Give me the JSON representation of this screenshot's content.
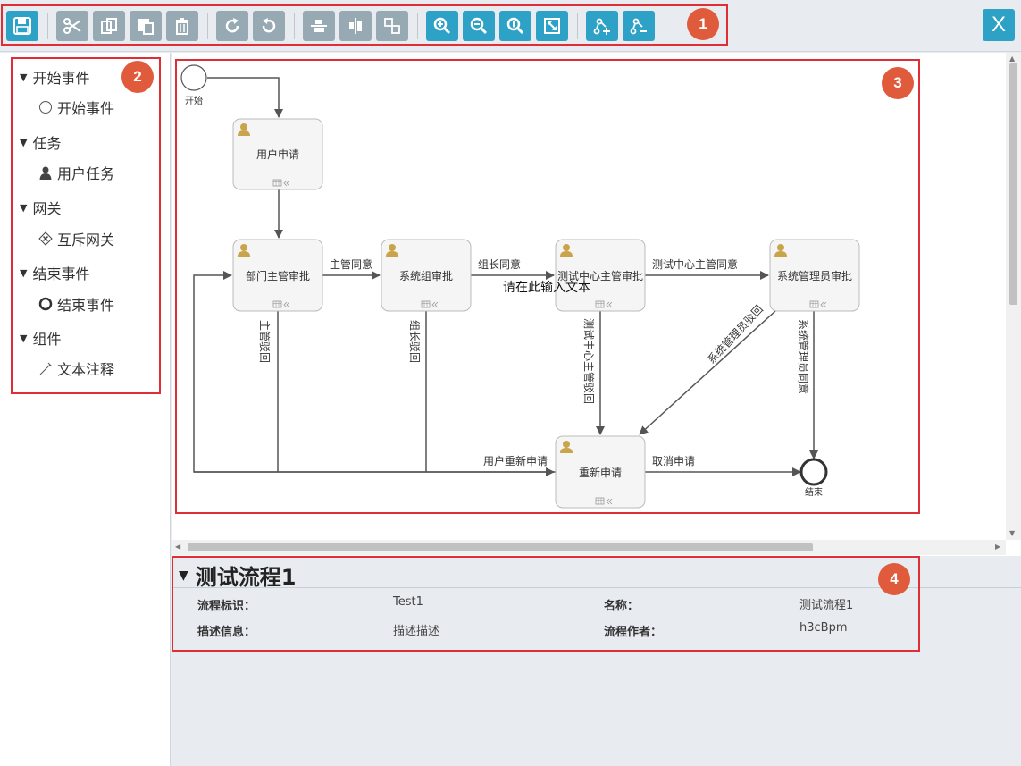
{
  "toolbar": {
    "close_label": "X",
    "callout": "1"
  },
  "palette": {
    "callout": "2",
    "groups": [
      {
        "label": "开始事件",
        "item": "开始事件"
      },
      {
        "label": "任务",
        "item": "用户任务"
      },
      {
        "label": "网关",
        "item": "互斥网关"
      },
      {
        "label": "结束事件",
        "item": "结束事件"
      },
      {
        "label": "组件",
        "item": "文本注释"
      }
    ]
  },
  "diagram": {
    "callout": "3",
    "start_label": "开始",
    "end_label": "结束",
    "nodes": {
      "user_request": "用户申请",
      "dept_approve": "部门主管审批",
      "sys_group_approve": "系统组审批",
      "test_center_approve": "测试中心主管审批",
      "sys_admin_approve": "系统管理员审批",
      "reapply": "重新申请"
    },
    "edges": {
      "mgr_agree": "主管同意",
      "leader_agree": "组长同意",
      "test_center_agree": "测试中心主管同意",
      "mgr_reject": "主管驳回",
      "leader_reject": "组长驳回",
      "test_center_reject": "测试中心主管驳回",
      "admin_reject": "系统管理员驳回",
      "admin_agree": "系统管理员同意",
      "user_reapply": "用户重新申请",
      "cancel_request": "取消申请"
    },
    "text_annotation": "请在此输入文本"
  },
  "properties": {
    "callout": "4",
    "title": "测试流程1",
    "fields": {
      "process_id_label": "流程标识：",
      "process_id_value": "Test1",
      "name_label": "名称：",
      "name_value": "测试流程1",
      "description_label": "描述信息：",
      "description_value": "描述描述",
      "author_label": "流程作者：",
      "author_value": "h3cBpm"
    }
  },
  "colors": {
    "accent": "#2ea2c6",
    "toolbar_gray": "#97a9b3",
    "callout": "#e05a3c",
    "highlight_box": "#e02e36",
    "user_icon": "#c9a44a"
  }
}
